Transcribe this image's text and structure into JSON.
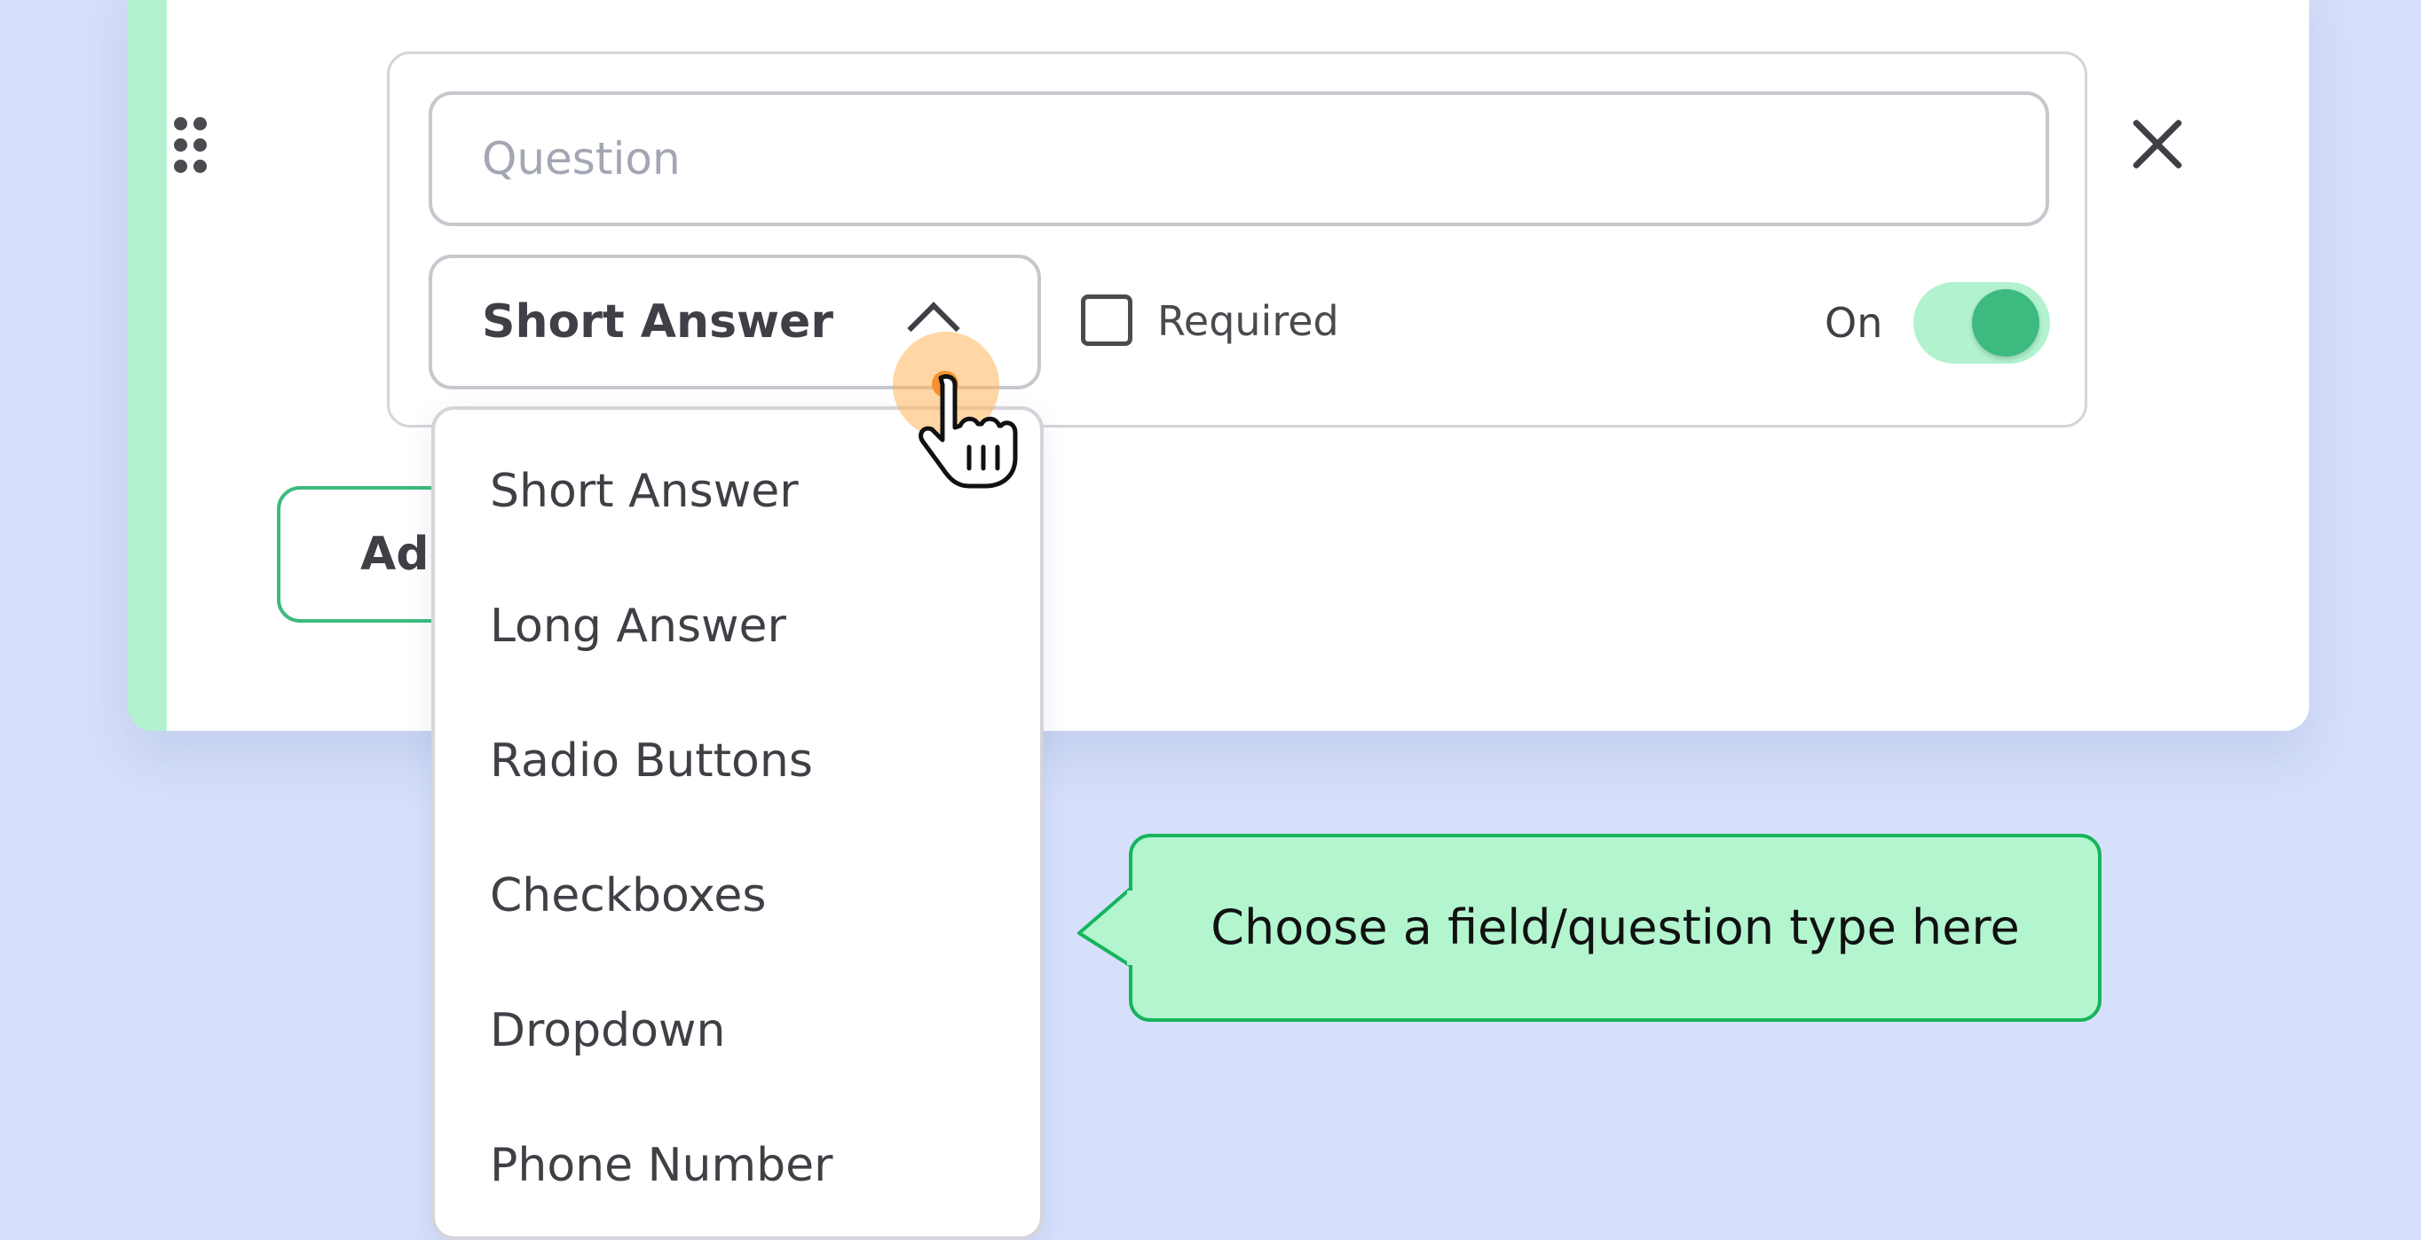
{
  "form_builder": {
    "question_placeholder": "Question",
    "field_type_selected": "Short Answer",
    "required_label": "Required",
    "required_checked": false,
    "toggle_label": "On",
    "toggle_on": true,
    "add_button_label": "Add"
  },
  "dropdown": {
    "items": [
      "Short Answer",
      "Long Answer",
      "Radio Buttons",
      "Checkboxes",
      "Dropdown",
      "Phone Number"
    ]
  },
  "tooltip": {
    "text": "Choose a field/question type here"
  },
  "colors": {
    "background": "#d6e0fb",
    "accent_green": "#3dba7f",
    "accent_green_light": "#b2f2cf",
    "callout_border": "#16b45c",
    "text": "#3f3f46"
  },
  "icons": [
    "drag-handle-icon",
    "chevron-up-icon",
    "close-icon",
    "hand-cursor-icon"
  ]
}
